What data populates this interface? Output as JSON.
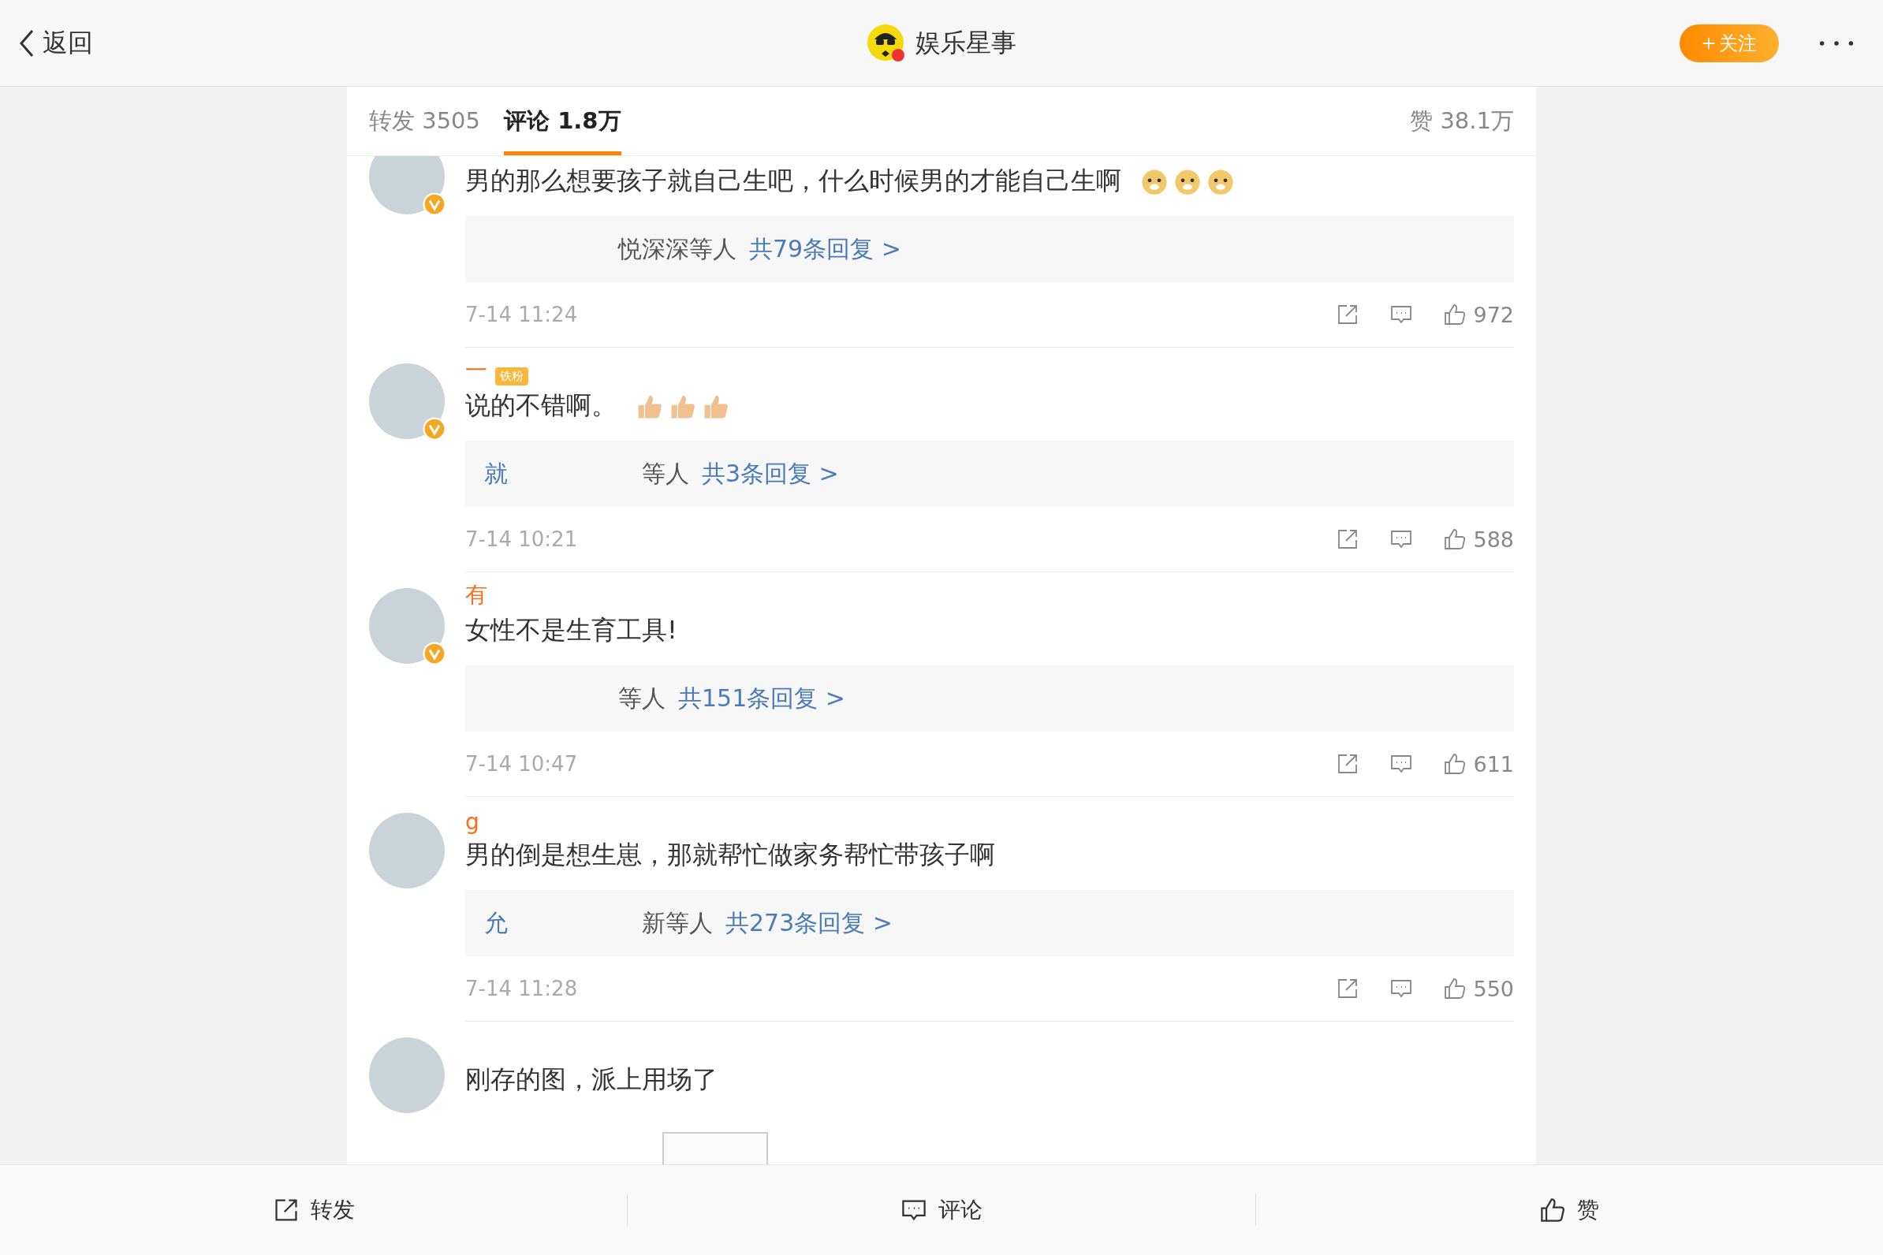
{
  "nav": {
    "back": "返回",
    "title": "娱乐星事",
    "follow": "关注"
  },
  "tabs": [
    {
      "label": "转发 3505",
      "selected": false
    },
    {
      "label": "评论 1.8万",
      "selected": true
    }
  ],
  "likes_tab": "赞 38.1万",
  "comments": [
    {
      "verified": true,
      "text": "男的那么想要孩子就自己生吧，什么时候男的才能自己生啊",
      "emojis": [
        {
          "kind": "dog"
        },
        {
          "kind": "dog"
        },
        {
          "kind": "dog"
        }
      ],
      "reply_suffix": "悦深深等人",
      "reply_count": "共79条回复 >",
      "time": "7-14 11:24",
      "likes": "972"
    },
    {
      "name": "一",
      "verified": true,
      "badge": "铁粉",
      "text": "说的不错啊。",
      "emojis": [
        {
          "kind": "thumb"
        },
        {
          "kind": "thumb"
        },
        {
          "kind": "thumb"
        }
      ],
      "reply_prefix": "就",
      "reply_suffix": "等人",
      "reply_count": "共3条回复 >",
      "time": "7-14 10:21",
      "likes": "588"
    },
    {
      "name": "有",
      "verified": true,
      "text": "女性不是生育工具!",
      "reply_suffix": "等人",
      "reply_count": "共151条回复 >",
      "time": "7-14 10:47",
      "likes": "611"
    },
    {
      "name": "g",
      "verified": false,
      "text": "男的倒是想生崽，那就帮忙做家务帮忙带孩子啊",
      "reply_prefix": "允",
      "reply_suffix": "新等人",
      "reply_count": "共273条回复 >",
      "time": "7-14 11:28",
      "likes": "550"
    },
    {
      "verified": false,
      "text": "刚存的图，派上用场了",
      "attachment": {
        "kind": "image"
      }
    }
  ],
  "bottom": [
    {
      "kind": "repost",
      "label": "转发"
    },
    {
      "kind": "comment",
      "label": "评论"
    },
    {
      "kind": "like",
      "label": "赞"
    }
  ]
}
